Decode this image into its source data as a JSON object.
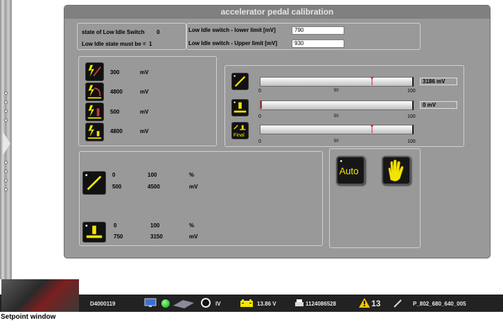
{
  "window": {
    "title": "accelerator pedal calibration"
  },
  "switch_info": {
    "state_label": "state of Low Idle Switch",
    "state_value": "0",
    "must_label": "Low Idle state must be =",
    "must_value": "1",
    "lower_label": "Low Idle switch - lower limit [mV]",
    "lower_value": "790",
    "upper_label": "Low Idle switch - Upper limit [mV]",
    "upper_value": "930"
  },
  "sensor_values": [
    {
      "value": "300",
      "unit": "mV",
      "icon": "sensor-lightning-ramp-icon"
    },
    {
      "value": "4800",
      "unit": "mV",
      "icon": "sensor-lightning-curve-icon"
    },
    {
      "value": "500",
      "unit": "mV",
      "icon": "sensor-lightning-bar-icon"
    },
    {
      "value": "4800",
      "unit": "mV",
      "icon": "sensor-lightning-bar-icon"
    }
  ],
  "sliders": [
    {
      "icon": "pedal-ramp-icon",
      "min": "0",
      "mid": "50",
      "max": "100",
      "position": 0.74,
      "readout": "3186 mV"
    },
    {
      "icon": "idle-switch-icon",
      "min": "0",
      "mid": "50",
      "max": "100",
      "position": 0.0,
      "readout": "0 mV"
    },
    {
      "icon": "final-icon",
      "icon_label": "Final",
      "min": "0",
      "mid": "50",
      "max": "100",
      "position": 0.74,
      "readout": ""
    }
  ],
  "ranges": [
    {
      "icon": "pedal-ramp-icon",
      "p_min": "0",
      "p_max": "100",
      "p_unit": "%",
      "mv_min": "500",
      "mv_max": "4500",
      "mv_unit": "mV"
    },
    {
      "icon": "idle-switch-icon",
      "p_min": "0",
      "p_max": "100",
      "p_unit": "%",
      "mv_min": "750",
      "mv_max": "3150",
      "mv_unit": "mV"
    }
  ],
  "buttons": {
    "auto_label": "Auto",
    "manual_icon": "hand-icon"
  },
  "status_bar": {
    "vehicle_id": "D4000119",
    "version": "IV",
    "voltage": "13.86 V",
    "counter": "1124086528",
    "warnings": "13",
    "software": "P_802_680_640_005"
  },
  "caption": "Setpoint window",
  "colors": {
    "panel": "#999999",
    "title_bar": "#808080",
    "icon_yellow": "#f2e600",
    "icon_bg": "#111111"
  }
}
